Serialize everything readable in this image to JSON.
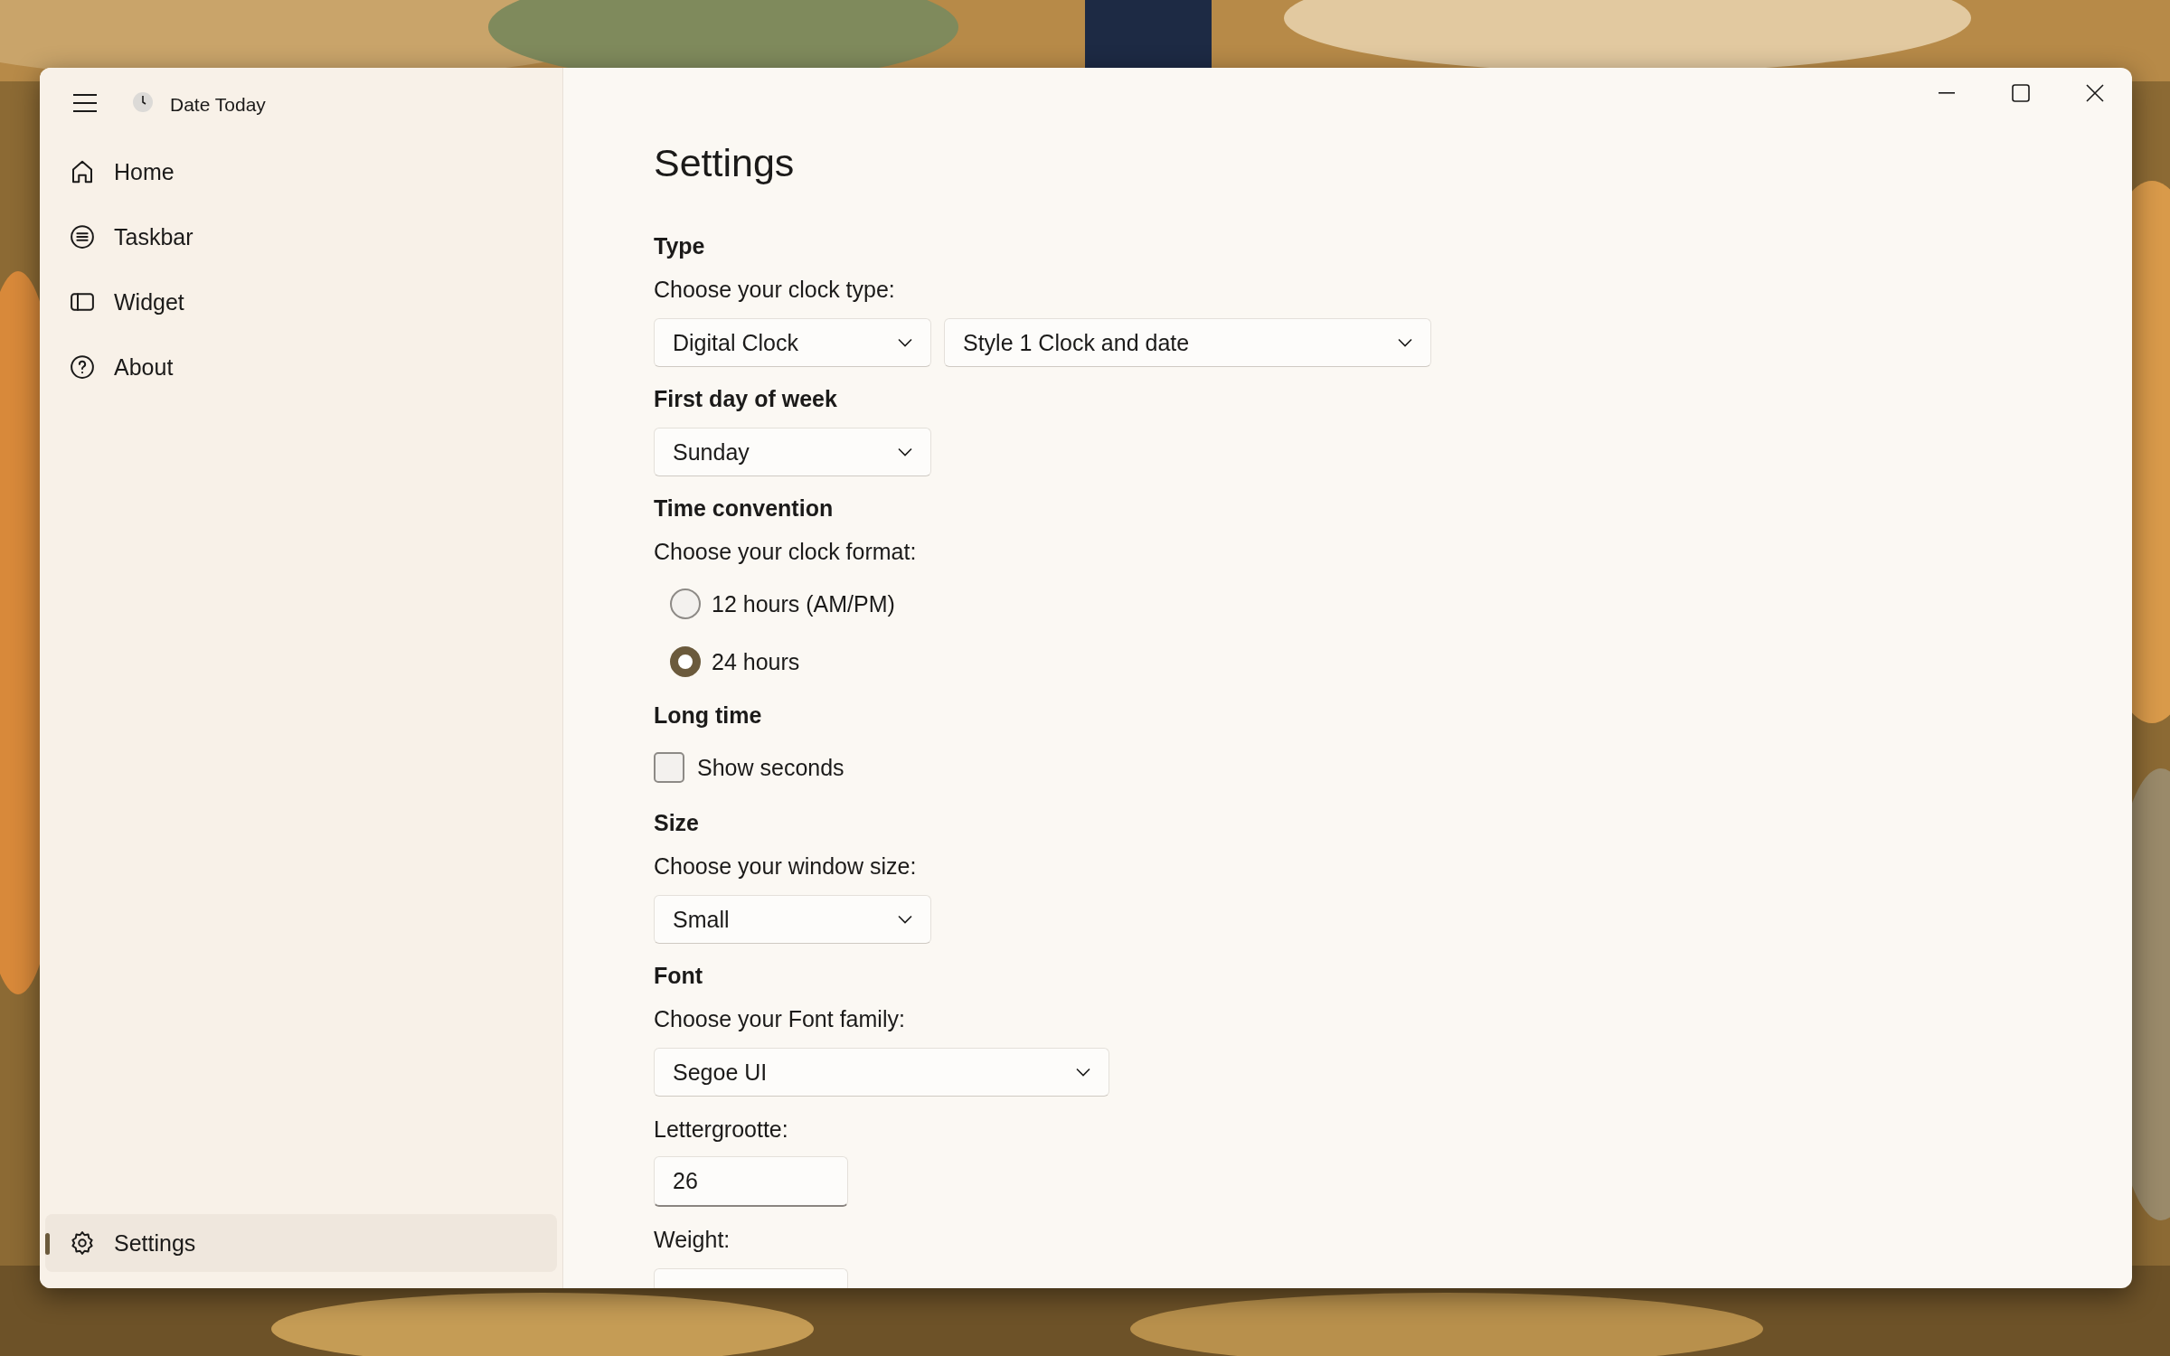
{
  "window": {
    "title": "Date Today"
  },
  "nav": {
    "items": [
      {
        "label": "Home",
        "selected": false
      },
      {
        "label": "Taskbar",
        "selected": false
      },
      {
        "label": "Widget",
        "selected": false
      },
      {
        "label": "About",
        "selected": false
      }
    ],
    "footer": [
      {
        "label": "Settings",
        "selected": true
      }
    ]
  },
  "page": {
    "title": "Settings",
    "controls": [
      {
        "kind": "heading",
        "text": "Type"
      },
      {
        "kind": "label",
        "text": "Choose your clock type:"
      },
      {
        "kind": "dropdowns",
        "items": [
          {
            "value": "Digital Clock"
          },
          {
            "value": "Style 1 Clock and date"
          }
        ]
      },
      {
        "kind": "heading",
        "text": "First day of week"
      },
      {
        "kind": "dropdowns",
        "items": [
          {
            "value": "Sunday"
          }
        ]
      },
      {
        "kind": "heading",
        "text": "Time convention"
      },
      {
        "kind": "label",
        "text": "Choose your clock format:"
      },
      {
        "kind": "radio",
        "label": "12 hours (AM/PM)",
        "selected": false
      },
      {
        "kind": "radio",
        "label": "24 hours",
        "selected": true
      },
      {
        "kind": "heading",
        "text": "Long time"
      },
      {
        "kind": "checkbox",
        "label": "Show seconds",
        "checked": false
      },
      {
        "kind": "heading",
        "text": "Size"
      },
      {
        "kind": "label",
        "text": "Choose your window size:"
      },
      {
        "kind": "dropdowns",
        "items": [
          {
            "value": "Small"
          }
        ]
      },
      {
        "kind": "heading",
        "text": "Font"
      },
      {
        "kind": "label",
        "text": "Choose your Font family:"
      },
      {
        "kind": "dropdowns",
        "items": [
          {
            "value": "Segoe UI"
          }
        ]
      },
      {
        "kind": "label",
        "text": "Lettergrootte:"
      },
      {
        "kind": "textbox",
        "value": "26"
      },
      {
        "kind": "label",
        "text": "Weight:"
      },
      {
        "kind": "dropdown"
      }
    ]
  }
}
